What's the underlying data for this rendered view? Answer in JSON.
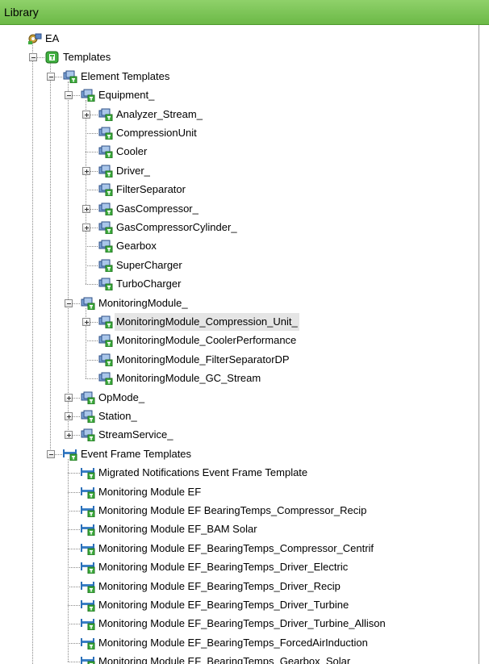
{
  "title": "Library",
  "colors": {
    "header": "#7cc45a",
    "template_green": "#3fae3f",
    "element_blue": "#5b86c4"
  },
  "tree": [
    {
      "label": "EA",
      "level": 0,
      "icon": "ea-database-icon",
      "expander": "none"
    },
    {
      "label": "Templates",
      "level": 1,
      "icon": "templates-folder-icon",
      "expander": "minus"
    },
    {
      "label": "Element Templates",
      "level": 2,
      "icon": "element-template-icon",
      "expander": "minus"
    },
    {
      "label": "Equipment_",
      "level": 3,
      "icon": "element-template-icon",
      "expander": "minus"
    },
    {
      "label": "Analyzer_Stream_",
      "level": 4,
      "icon": "element-template-icon",
      "expander": "plus"
    },
    {
      "label": "CompressionUnit",
      "level": 4,
      "icon": "element-template-icon",
      "expander": "none"
    },
    {
      "label": "Cooler",
      "level": 4,
      "icon": "element-template-icon",
      "expander": "none"
    },
    {
      "label": "Driver_",
      "level": 4,
      "icon": "element-template-icon",
      "expander": "plus"
    },
    {
      "label": "FilterSeparator",
      "level": 4,
      "icon": "element-template-icon",
      "expander": "none"
    },
    {
      "label": "GasCompressor_",
      "level": 4,
      "icon": "element-template-icon",
      "expander": "plus"
    },
    {
      "label": "GasCompressorCylinder_",
      "level": 4,
      "icon": "element-template-icon",
      "expander": "plus"
    },
    {
      "label": "Gearbox",
      "level": 4,
      "icon": "element-template-icon",
      "expander": "none"
    },
    {
      "label": "SuperCharger",
      "level": 4,
      "icon": "element-template-icon",
      "expander": "none"
    },
    {
      "label": "TurboCharger",
      "level": 4,
      "icon": "element-template-icon",
      "expander": "none"
    },
    {
      "label": "MonitoringModule_",
      "level": 3,
      "icon": "element-template-icon",
      "expander": "minus"
    },
    {
      "label": "MonitoringModule_Compression_Unit_",
      "level": 4,
      "icon": "element-template-icon",
      "expander": "plus",
      "selected": true
    },
    {
      "label": "MonitoringModule_CoolerPerformance",
      "level": 4,
      "icon": "element-template-icon",
      "expander": "none"
    },
    {
      "label": "MonitoringModule_FilterSeparatorDP",
      "level": 4,
      "icon": "element-template-icon",
      "expander": "none"
    },
    {
      "label": "MonitoringModule_GC_Stream",
      "level": 4,
      "icon": "element-template-icon",
      "expander": "none"
    },
    {
      "label": "OpMode_",
      "level": 3,
      "icon": "element-template-icon",
      "expander": "plus"
    },
    {
      "label": "Station_",
      "level": 3,
      "icon": "element-template-icon",
      "expander": "plus"
    },
    {
      "label": "StreamService_",
      "level": 3,
      "icon": "element-template-icon",
      "expander": "plus"
    },
    {
      "label": "Event Frame Templates",
      "level": 2,
      "icon": "event-frame-template-icon",
      "expander": "minus"
    },
    {
      "label": "Migrated Notifications Event Frame Template",
      "level": 3,
      "icon": "event-frame-template-icon",
      "expander": "none"
    },
    {
      "label": "Monitoring Module EF",
      "level": 3,
      "icon": "event-frame-template-icon",
      "expander": "none"
    },
    {
      "label": "Monitoring Module EF BearingTemps_Compressor_Recip",
      "level": 3,
      "icon": "event-frame-template-icon",
      "expander": "none"
    },
    {
      "label": "Monitoring Module EF_BAM Solar",
      "level": 3,
      "icon": "event-frame-template-icon",
      "expander": "none"
    },
    {
      "label": "Monitoring Module EF_BearingTemps_Compressor_Centrif",
      "level": 3,
      "icon": "event-frame-template-icon",
      "expander": "none"
    },
    {
      "label": "Monitoring Module EF_BearingTemps_Driver_Electric",
      "level": 3,
      "icon": "event-frame-template-icon",
      "expander": "none"
    },
    {
      "label": "Monitoring Module EF_BearingTemps_Driver_Recip",
      "level": 3,
      "icon": "event-frame-template-icon",
      "expander": "none"
    },
    {
      "label": "Monitoring Module EF_BearingTemps_Driver_Turbine",
      "level": 3,
      "icon": "event-frame-template-icon",
      "expander": "none"
    },
    {
      "label": "Monitoring Module EF_BearingTemps_Driver_Turbine_Allison",
      "level": 3,
      "icon": "event-frame-template-icon",
      "expander": "none"
    },
    {
      "label": "Monitoring Module EF_BearingTemps_ForcedAirInduction",
      "level": 3,
      "icon": "event-frame-template-icon",
      "expander": "none"
    },
    {
      "label": "Monitoring Module EF_BearingTemps_Gearbox_Solar",
      "level": 3,
      "icon": "event-frame-template-icon",
      "expander": "none"
    }
  ]
}
